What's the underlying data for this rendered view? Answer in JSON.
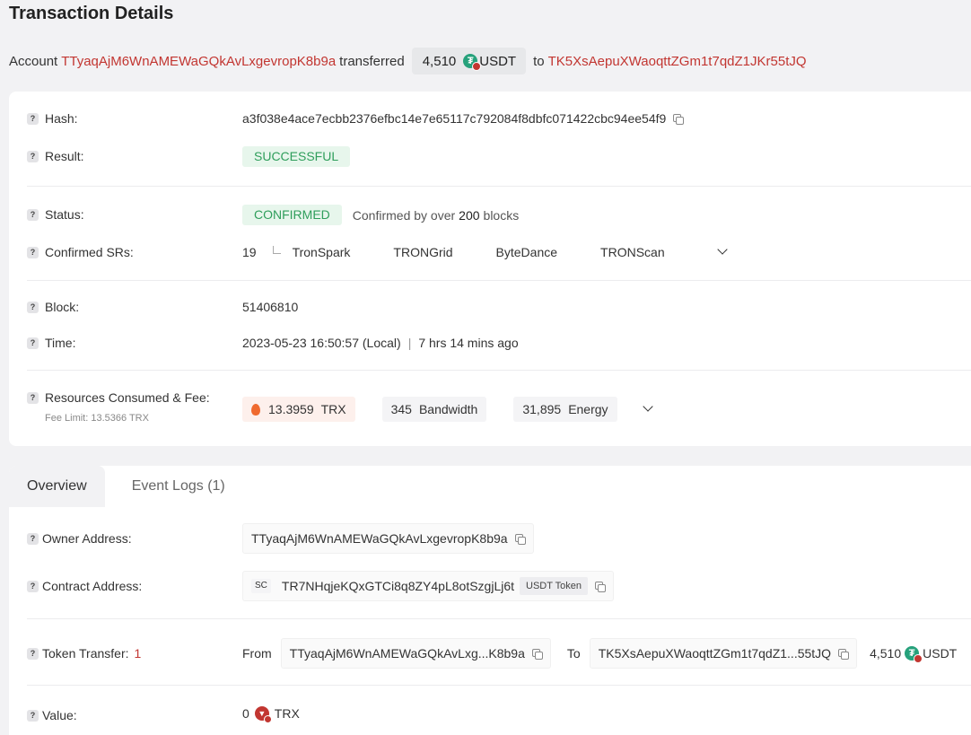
{
  "page": {
    "title": "Transaction Details"
  },
  "summary": {
    "account_word": "Account",
    "from_address": "TTyaqAjM6WnAMEWaGQkAvLxgevropK8b9a",
    "transferred_word": "transferred",
    "amount": "4,510",
    "token": "USDT",
    "to_word": "to",
    "to_address": "TK5XsAepuXWaoqttZGm1t7qdZ1JKr55tJQ"
  },
  "details": {
    "hash_label": "Hash:",
    "hash": "a3f038e4ace7ecbb2376efbc14e7e65117c792084f8dbfc071422cbc94ee54f9",
    "result_label": "Result:",
    "result": "SUCCESSFUL",
    "status_label": "Status:",
    "status": "CONFIRMED",
    "confirmed_prefix": "Confirmed by over",
    "confirmed_blocks": "200",
    "confirmed_suffix": "blocks",
    "srs_label": "Confirmed SRs:",
    "srs_count": "19",
    "srs": [
      "TronSpark",
      "TRONGrid",
      "ByteDance",
      "TRONScan"
    ],
    "block_label": "Block:",
    "block": "51406810",
    "time_label": "Time:",
    "time": "2023-05-23 16:50:57 (Local)",
    "time_sep": "|",
    "time_ago": "7 hrs 14 mins ago",
    "resources_label": "Resources Consumed & Fee:",
    "fee_limit": "Fee Limit: 13.5366 TRX",
    "fee_value": "13.3959",
    "fee_unit": "TRX",
    "bandwidth_value": "345",
    "bandwidth_unit": "Bandwidth",
    "energy_value": "31,895",
    "energy_unit": "Energy"
  },
  "tabs": [
    {
      "label": "Overview"
    },
    {
      "label": "Event Logs (1)"
    }
  ],
  "overview": {
    "owner_label": "Owner Address:",
    "owner": "TTyaqAjM6WnAMEWaGQkAvLxgevropK8b9a",
    "contract_label": "Contract Address:",
    "contract_badge": "SC",
    "contract": "TR7NHqjeKQxGTCi8q8ZY4pL8otSzgjLj6t",
    "contract_tag": "USDT Token",
    "transfer_label": "Token Transfer:",
    "transfer_count": "1",
    "from_word": "From",
    "from": "TTyaqAjM6WnAMEWaGQkAvLxg...K8b9a",
    "to_word": "To",
    "to": "TK5XsAepuXWaoqttZGm1t7qdZ1...55tJQ",
    "transfer_amount": "4,510",
    "transfer_token": "USDT",
    "value_label": "Value:",
    "value": "0",
    "value_unit": "TRX"
  },
  "icons": {
    "help": "question-mark-icon",
    "copy": "copy-icon",
    "usdt": "tether-icon",
    "trx": "tron-icon",
    "fee": "fire-icon",
    "expand": "chevron-down-icon"
  },
  "colors": {
    "link": "#c23631",
    "success_bg": "#e7f6ec",
    "success_text": "#2f9e5b",
    "page_bg": "#f2f2f4",
    "tether": "#26a17b"
  }
}
